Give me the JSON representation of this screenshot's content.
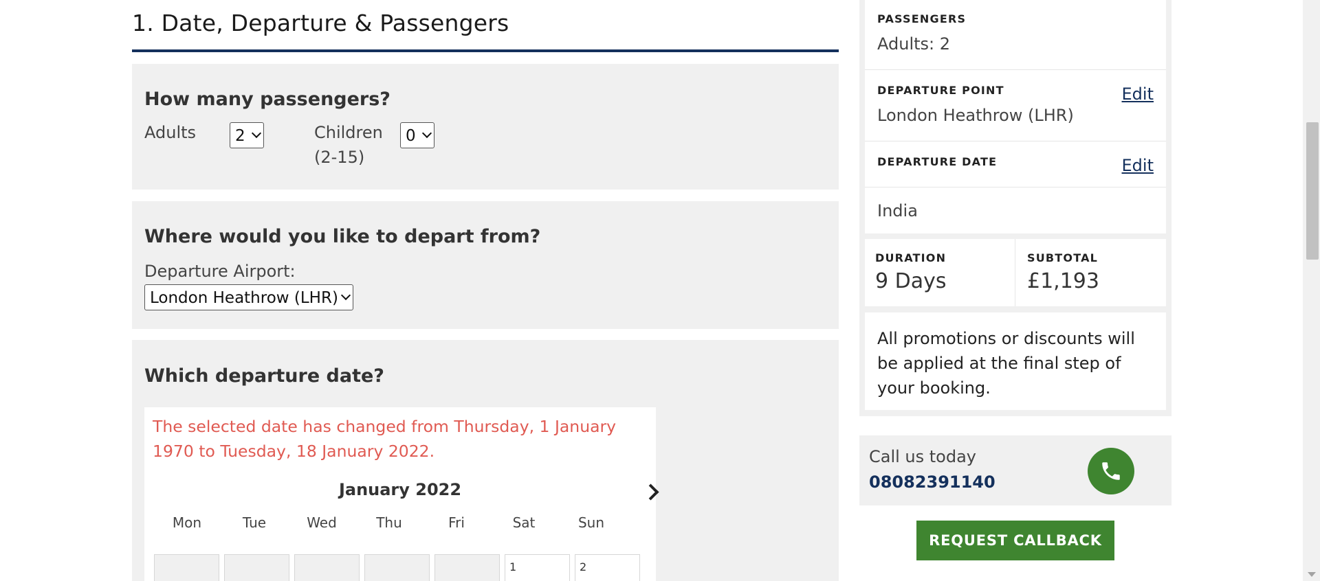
{
  "section": {
    "title": "1. Date, Departure & Passengers"
  },
  "passengers_panel": {
    "heading": "How many passengers?",
    "adults_label": "Adults",
    "adults_value": "2",
    "children_label": "Children",
    "children_age": "(2-15)",
    "children_value": "0"
  },
  "departure_panel": {
    "heading": "Where would you like to depart from?",
    "airport_label": "Departure Airport:",
    "airport_value": "London Heathrow (LHR)"
  },
  "date_panel": {
    "heading": "Which departure date?",
    "warning": "The selected date has changed from Thursday, 1 January 1970 to Tuesday, 18 January 2022.",
    "month": "January 2022",
    "weekdays": [
      "Mon",
      "Tue",
      "Wed",
      "Thu",
      "Fri",
      "Sat",
      "Sun"
    ],
    "first_row": [
      "",
      "",
      "",
      "",
      "",
      "1",
      "2"
    ]
  },
  "summary": {
    "passengers_label": "PASSENGERS",
    "passengers_value": "Adults: 2",
    "departure_point_label": "DEPARTURE POINT",
    "departure_point_value": "London Heathrow (LHR)",
    "departure_date_label": "DEPARTURE DATE",
    "edit_label": "Edit",
    "destination": "India",
    "duration_label": "DURATION",
    "duration_value": "9 Days",
    "subtotal_label": "SUBTOTAL",
    "subtotal_value": "£1,193",
    "promo_text": "All promotions or discounts will be applied at the final step of your booking."
  },
  "contact": {
    "call_text": "Call us today",
    "phone_number": "08082391140",
    "phone_icon": "phone-icon",
    "callback_label": "REQUEST CALLBACK"
  },
  "colors": {
    "navy": "#14305c",
    "green": "#3f8530",
    "warning_red": "#e05a52",
    "panel_grey": "#f0f0f0"
  }
}
